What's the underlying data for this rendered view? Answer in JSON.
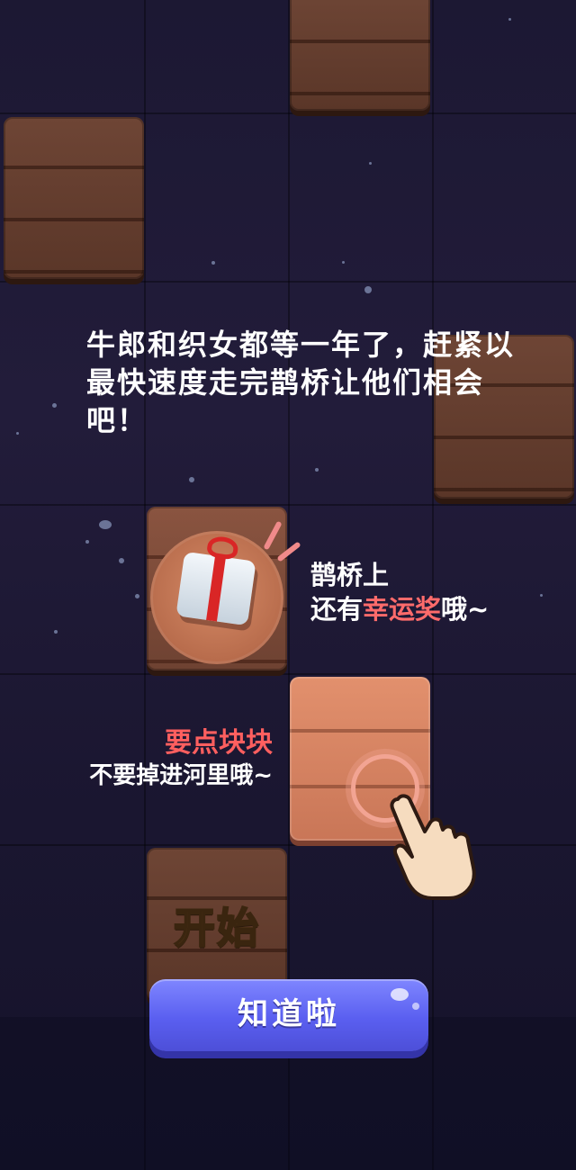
{
  "intro": {
    "text": "牛郎和织女都等一年了，赶紧以最快速度走完鹊桥让他们相会吧！"
  },
  "tips": {
    "lucky_line1": "鹊桥上",
    "lucky_prefix": "还有",
    "lucky_highlight": "幸运奖",
    "lucky_suffix": "哦~",
    "tap_highlight": "要点块块",
    "tap_line2": "不要掉进河里哦~"
  },
  "start_tile": {
    "label": "开始"
  },
  "confirm_button": {
    "label": "知道啦"
  },
  "colors": {
    "background": "#1c1833",
    "tile_dark": "#5a3628",
    "tile_light": "#e2906d",
    "highlight_text": "#ff6b6b",
    "button": "#5a5ff0"
  },
  "icons": [
    "gift-icon",
    "tap-ring-icon",
    "pointing-hand-icon"
  ]
}
